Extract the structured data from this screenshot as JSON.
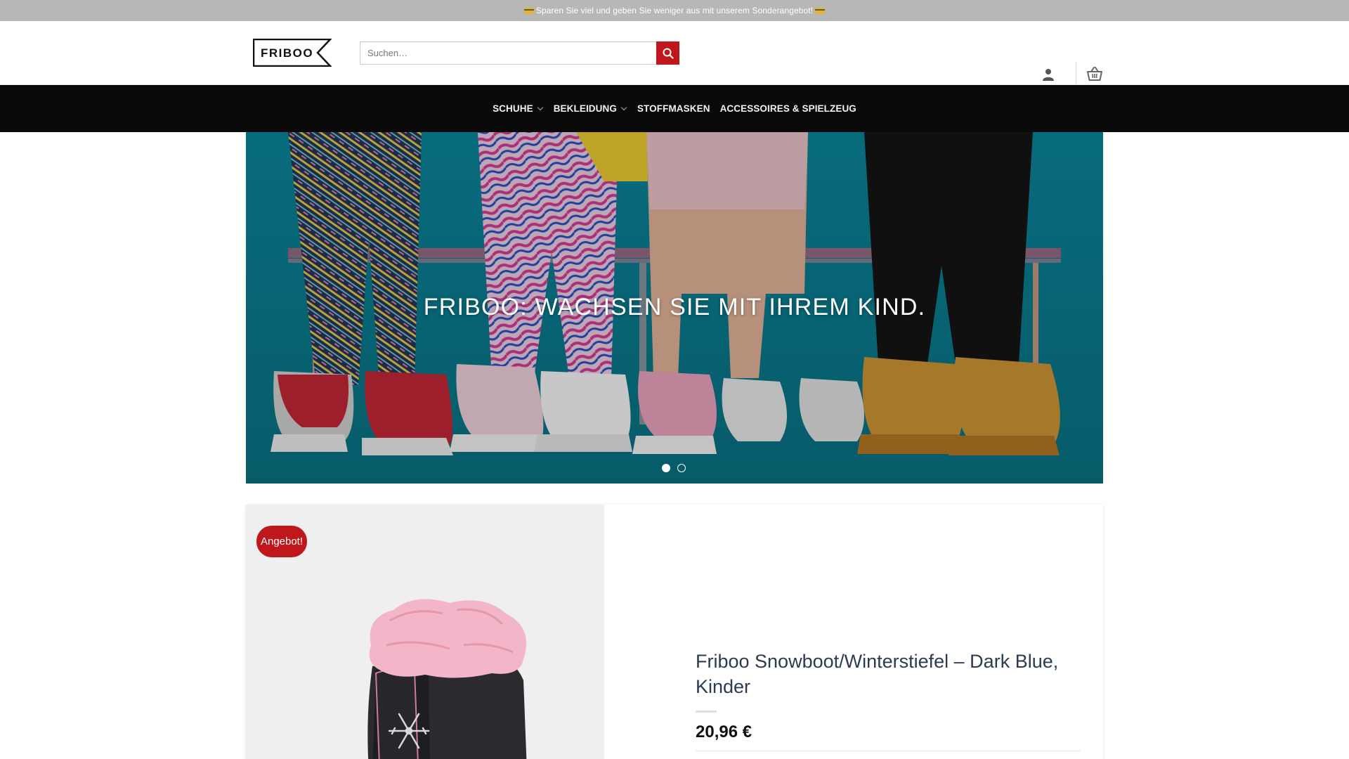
{
  "promo": {
    "text": "Sparen Sie viel und geben Sie weniger aus mit unserem Sonderangebot!"
  },
  "header": {
    "logo_text": "FRIBOO",
    "search_placeholder": "Suchen…",
    "icons": {
      "search": "search-icon",
      "account": "user-icon",
      "cart": "basket-icon"
    }
  },
  "nav": {
    "items": [
      {
        "label": "SCHUHE",
        "has_dropdown": true
      },
      {
        "label": "BEKLEIDUNG",
        "has_dropdown": true
      },
      {
        "label": "STOFFMASKEN",
        "has_dropdown": false
      },
      {
        "label": "ACCESSOIRES & SPIELZEUG",
        "has_dropdown": false
      }
    ]
  },
  "hero": {
    "title": "FRIBOO: WACHSEN SIE MIT IHREM KIND.",
    "slides": 2,
    "active_slide": 1
  },
  "product": {
    "badge": "Angebot!",
    "title": "Friboo Snowboot/Winterstiefel – Dark Blue, Kinder",
    "price": "20,96 €"
  },
  "colors": {
    "promo_bg": "#b7b7b7",
    "nav_bg": "#0a0a0a",
    "accent": "#c0171c",
    "hero_bg": "#0d7f95",
    "title": "#2d3b52"
  }
}
